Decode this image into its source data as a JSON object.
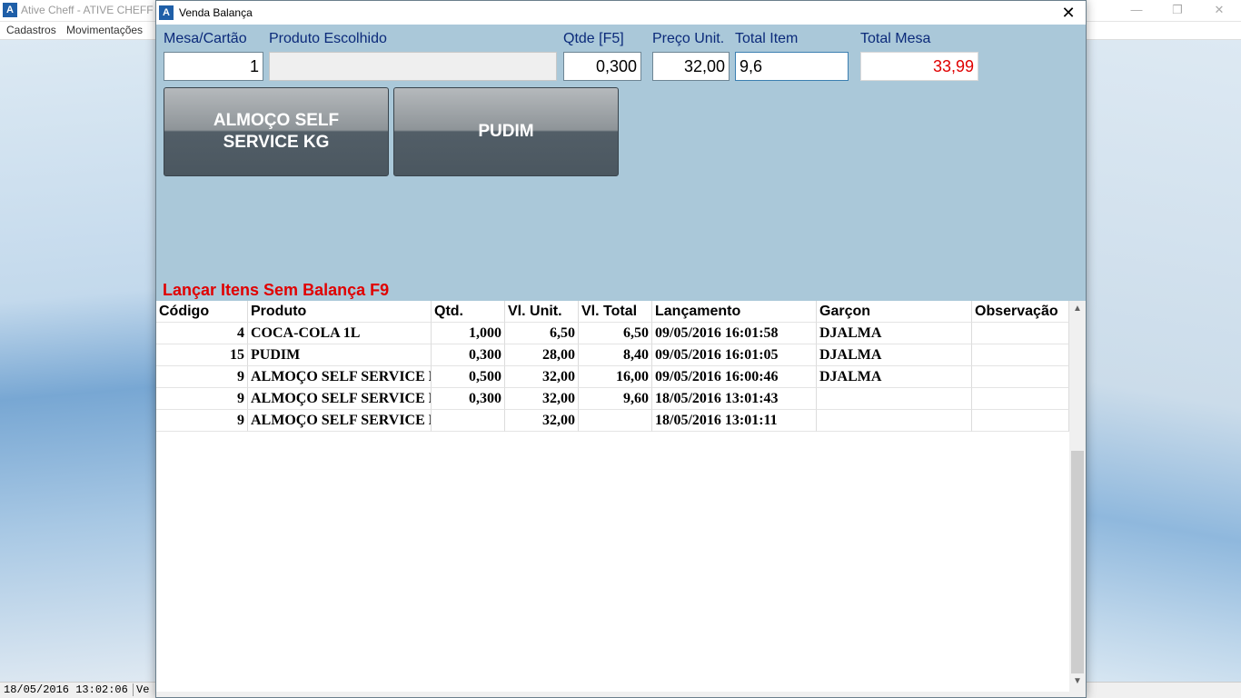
{
  "background_window": {
    "title": "Ative Cheff - ATIVE CHEFF",
    "menu": [
      "Cadastros",
      "Movimentações"
    ],
    "controls": {
      "minimize": "—",
      "restore": "❐",
      "close": "✕"
    },
    "status": {
      "datetime": "18/05/2016 13:02:06",
      "extra": "Ve"
    }
  },
  "dialog": {
    "title": "Venda Balança",
    "close_glyph": "✕",
    "labels": {
      "mesa": "Mesa/Cartão",
      "produto": "Produto Escolhido",
      "qtde": "Qtde [F5]",
      "preco": "Preço Unit.",
      "total_item": "Total Item",
      "total_mesa": "Total Mesa"
    },
    "fields": {
      "mesa": "1",
      "produto": "",
      "qtde": "0,300",
      "preco": "32,00",
      "total_item": "9,6",
      "total_mesa": "33,99"
    },
    "product_buttons": [
      "ALMOÇO SELF SERVICE KG",
      "PUDIM"
    ],
    "f9_label": "Lançar Itens Sem Balança F9"
  },
  "grid": {
    "columns": [
      "Código",
      "Produto",
      "Qtd.",
      "Vl. Unit.",
      "Vl. Total",
      "Lançamento",
      "Garçon",
      "Observação"
    ],
    "rows": [
      {
        "codigo": "4",
        "produto": "COCA-COLA 1L",
        "qtd": "1,000",
        "vl_unit": "6,50",
        "vl_total": "6,50",
        "lancamento": "09/05/2016 16:01:58",
        "garcon": "DJALMA",
        "obs": ""
      },
      {
        "codigo": "15",
        "produto": "PUDIM",
        "qtd": "0,300",
        "vl_unit": "28,00",
        "vl_total": "8,40",
        "lancamento": "09/05/2016 16:01:05",
        "garcon": "DJALMA",
        "obs": ""
      },
      {
        "codigo": "9",
        "produto": "ALMOÇO SELF SERVICE KG",
        "qtd": "0,500",
        "vl_unit": "32,00",
        "vl_total": "16,00",
        "lancamento": "09/05/2016 16:00:46",
        "garcon": "DJALMA",
        "obs": ""
      },
      {
        "codigo": "9",
        "produto": "ALMOÇO SELF SERVICE KG",
        "qtd": "0,300",
        "vl_unit": "32,00",
        "vl_total": "9,60",
        "lancamento": "18/05/2016 13:01:43",
        "garcon": "",
        "obs": ""
      },
      {
        "codigo": "9",
        "produto": "ALMOÇO SELF SERVICE KG",
        "qtd": "",
        "vl_unit": "32,00",
        "vl_total": "",
        "lancamento": "18/05/2016 13:01:11",
        "garcon": "",
        "obs": ""
      }
    ],
    "scroll_up": "▲",
    "scroll_down": "▼"
  }
}
